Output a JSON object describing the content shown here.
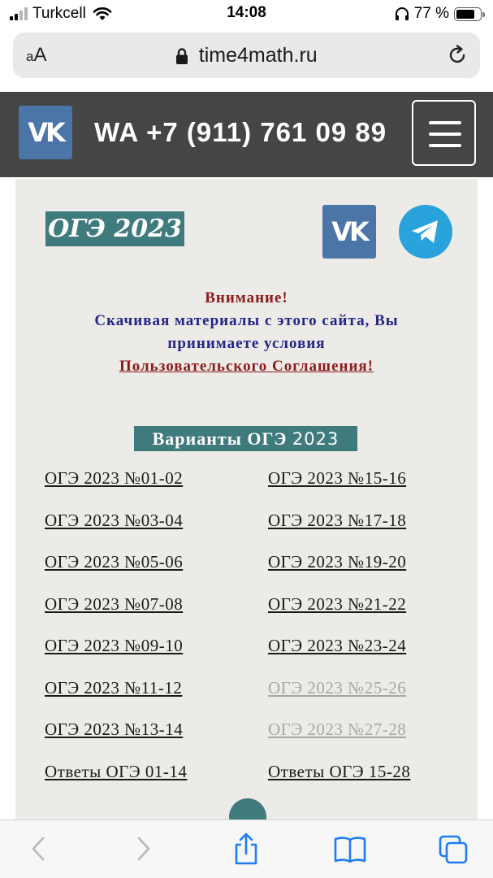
{
  "status_bar": {
    "carrier": "Turkcell",
    "time": "14:08",
    "battery": "77 %",
    "battery_level": 0.77
  },
  "address_bar": {
    "aa_label": "AA",
    "url": "time4math.ru"
  },
  "site_header": {
    "phone": "WA +7 (911) 761 09 89",
    "vk_label": "VK"
  },
  "content": {
    "badge": "ОГЭ 2023",
    "notice": {
      "line1": "Внимание!",
      "line2": "Скачивая материалы с этого сайта, Вы",
      "line3": "принимаете условия",
      "line4": "Пользовательского Соглашения!"
    },
    "section": {
      "title": "Варианты ОГЭ",
      "year": "2023"
    },
    "variants_left": [
      {
        "label": "ОГЭ 2023 №01-02"
      },
      {
        "label": "ОГЭ 2023 №03-04"
      },
      {
        "label": "ОГЭ 2023 №05-06"
      },
      {
        "label": "ОГЭ 2023 №07-08"
      },
      {
        "label": "ОГЭ 2023 №09-10"
      },
      {
        "label": "ОГЭ 2023 №11-12"
      },
      {
        "label": "ОГЭ 2023 №13-14"
      },
      {
        "label": "Ответы ОГЭ 01-14"
      }
    ],
    "variants_right": [
      {
        "label": "ОГЭ 2023 №15-16"
      },
      {
        "label": "ОГЭ 2023 №17-18"
      },
      {
        "label": "ОГЭ 2023 №19-20"
      },
      {
        "label": "ОГЭ 2023 №21-22"
      },
      {
        "label": "ОГЭ 2023 №23-24"
      },
      {
        "label": "ОГЭ 2023 №25-26"
      },
      {
        "label": "ОГЭ 2023 №27-28"
      },
      {
        "label": "Ответы ОГЭ 15-28"
      }
    ]
  },
  "colors": {
    "header_bg": "#444544",
    "accent_teal": "#3f7a7d",
    "vk_blue": "#4b74a7",
    "telegram_blue": "#2aa3dd",
    "notice_red": "#8b1a1a",
    "notice_blue": "#23238a",
    "disabled_link": "#a7a7a7"
  },
  "icons": [
    "signal-icon",
    "wifi-icon",
    "headphones-icon",
    "battery-icon",
    "lock-icon",
    "reload-icon",
    "vk-icon",
    "hamburger-menu-icon",
    "telegram-icon",
    "back-icon",
    "forward-icon",
    "share-icon",
    "bookmarks-icon",
    "tabs-icon"
  ]
}
